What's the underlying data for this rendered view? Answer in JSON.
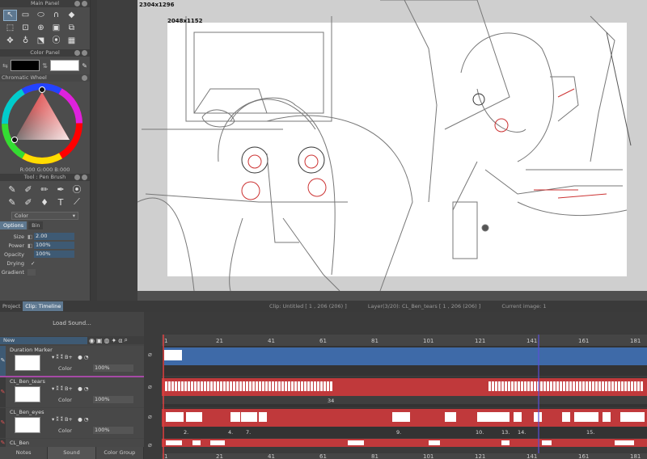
{
  "main_panel": {
    "title": "Main Panel",
    "tools": [
      {
        "icon": "select-arrow-icon",
        "glyph": "↖",
        "selected": true
      },
      {
        "icon": "rect-select-icon",
        "glyph": "▭"
      },
      {
        "icon": "ellipse-select-icon",
        "glyph": "⬭"
      },
      {
        "icon": "lasso-icon",
        "glyph": "∩"
      },
      {
        "icon": "eraser-icon",
        "glyph": "◆"
      },
      {
        "icon": "marquee-icon",
        "glyph": "⬚"
      },
      {
        "icon": "transform-icon",
        "glyph": "⊡"
      },
      {
        "icon": "zoom-icon",
        "glyph": "⊕"
      },
      {
        "icon": "fill-icon",
        "glyph": "▣"
      },
      {
        "icon": "stamp-icon",
        "glyph": "⧉"
      },
      {
        "icon": "move-icon",
        "glyph": "✥"
      },
      {
        "icon": "onion-icon",
        "glyph": "♁"
      },
      {
        "icon": "hand-icon",
        "glyph": "⬔"
      },
      {
        "icon": "eyedropper-icon",
        "glyph": "⦿"
      },
      {
        "icon": "grid-icon",
        "glyph": "▦"
      }
    ]
  },
  "color_panel": {
    "title": "Color Panel",
    "primary_color": "#000000",
    "secondary_color": "#ffffff",
    "wheel_label": "Chromatic Wheel",
    "rgb_text": "R:000  G:000  B:000"
  },
  "tool_panel": {
    "title": "Tool : Pen Brush",
    "brushes": [
      {
        "icon": "pen-icon",
        "glyph": "✎"
      },
      {
        "icon": "brush-icon",
        "glyph": "✐"
      },
      {
        "icon": "marker-icon",
        "glyph": "✏"
      },
      {
        "icon": "pencil-icon",
        "glyph": "✒"
      },
      {
        "icon": "dropper-icon",
        "glyph": "⦿"
      },
      {
        "icon": "blur-icon",
        "glyph": "✎"
      },
      {
        "icon": "smudge-icon",
        "glyph": "✐"
      },
      {
        "icon": "water-icon",
        "glyph": "♦"
      },
      {
        "icon": "text-icon",
        "glyph": "T"
      },
      {
        "icon": "line-icon",
        "glyph": "⟋"
      }
    ],
    "mode": "Color",
    "tabs": [
      "Options",
      "Bin"
    ],
    "properties": [
      {
        "label": "Size",
        "value": "2.00"
      },
      {
        "label": "Power",
        "value": "100%"
      },
      {
        "label": "Opacity",
        "value": "100%"
      },
      {
        "label": "Drying",
        "value": "✓"
      },
      {
        "label": "Gradient",
        "value": ""
      }
    ]
  },
  "canvas": {
    "size_full": "2304x1296",
    "size_frame": "2048x1152"
  },
  "timeline": {
    "tabs": [
      "Project",
      "Clip: Timeline"
    ],
    "clip_info": "Clip: Untitled [ 1 , 206  (206) ]",
    "layer_info": "Layer(3/20): CL_Ben_tears [ 1 , 206  (206) ]",
    "current_image": "Current image: 1",
    "load_sound": "Load Sound...",
    "new_label": "New",
    "frame_ticks": [
      "1",
      "21",
      "41",
      "61",
      "81",
      "101",
      "121",
      "141",
      "161",
      "181"
    ],
    "layers": [
      {
        "name": "Duration Marker",
        "opacity": "100%",
        "color_label": "Color"
      },
      {
        "name": "CL_Ben_tears",
        "opacity": "100%",
        "color_label": "Color"
      },
      {
        "name": "CL_Ben_eyes",
        "opacity": "100%",
        "color_label": "Color"
      },
      {
        "name": "CL_Ben",
        "opacity": "",
        "color_label": ""
      }
    ],
    "track_labels": {
      "tears": [
        "34"
      ],
      "eyes": [
        "2.",
        "4.",
        "7.",
        "9.",
        "10.",
        "13.",
        "14.",
        "15."
      ]
    },
    "bottom_tabs": [
      "Notes",
      "Sound",
      "Color Group"
    ],
    "colors": {
      "accent": "#3e6aa8",
      "cel": "#c0393b",
      "cursor": "#5a50d8",
      "marker": "#e04040"
    }
  }
}
